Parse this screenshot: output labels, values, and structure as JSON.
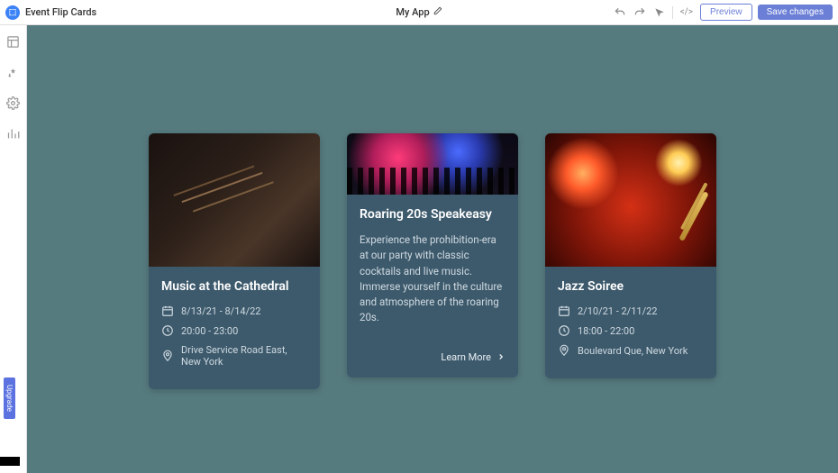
{
  "topbar": {
    "app_title": "Event Flip Cards",
    "project_name": "My App",
    "preview_label": "Preview",
    "save_label": "Save changes"
  },
  "sidebar": {
    "upgrade_label": "Upgrade"
  },
  "cards": [
    {
      "title": "Music at the Cathedral",
      "date": "8/13/21 - 8/14/22",
      "time": "20:00 - 23:00",
      "location": "Drive Service Road East, New York"
    },
    {
      "title": "Roaring 20s Speakeasy",
      "description": "Experience the prohibition-era at our party with classic cocktails and live music. Immerse yourself in the culture and atmosphere of the roaring 20s.",
      "learn_more_label": "Learn More"
    },
    {
      "title": "Jazz Soiree",
      "date": "2/10/21 - 2/11/22",
      "time": "18:00 - 22:00",
      "location": "Boulevard Que, New York"
    }
  ]
}
